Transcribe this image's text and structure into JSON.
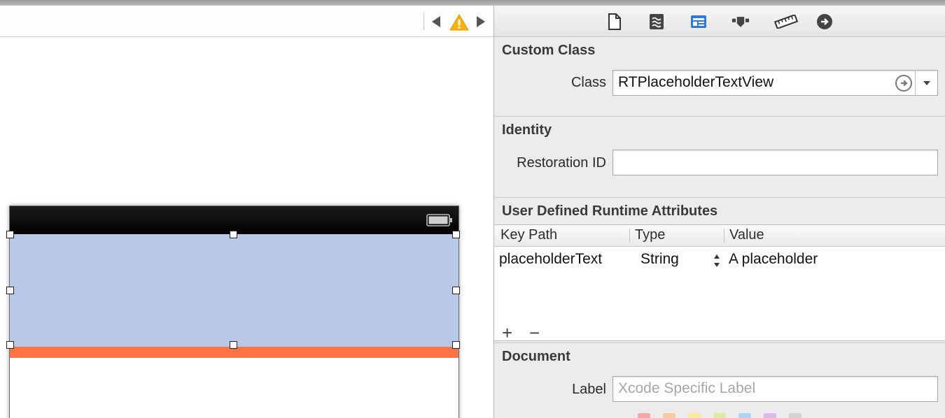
{
  "inspector": {
    "custom_class": {
      "title": "Custom Class",
      "class_label": "Class",
      "class_value": "RTPlaceholderTextView"
    },
    "identity": {
      "title": "Identity",
      "restoration_id_label": "Restoration ID",
      "restoration_id_value": ""
    },
    "runtime_attributes": {
      "title": "User Defined Runtime Attributes",
      "columns": [
        "Key Path",
        "Type",
        "Value"
      ],
      "rows": [
        {
          "key_path": "placeholderText",
          "type": "String",
          "value": "A placeholder"
        }
      ],
      "add_label": "+",
      "remove_label": "−"
    },
    "document": {
      "title": "Document",
      "label_label": "Label",
      "label_placeholder": "Xcode Specific Label",
      "label_colors": [
        "#f4a6a6",
        "#f8cc9c",
        "#f6ec9c",
        "#d6ef9e",
        "#a9d4f5",
        "#dcb8ef",
        "#d3d3d3"
      ]
    },
    "tabs": [
      "file-inspector-icon",
      "quick-help-icon",
      "identity-inspector-icon",
      "attributes-inspector-icon",
      "size-inspector-icon",
      "connections-inspector-icon"
    ],
    "active_tab_color": "#2f7ad8"
  },
  "canvas": {
    "text_view_color": "#b7c9e6",
    "accent_strip_color": "#fe7447",
    "warning_color": "#f7b500"
  }
}
